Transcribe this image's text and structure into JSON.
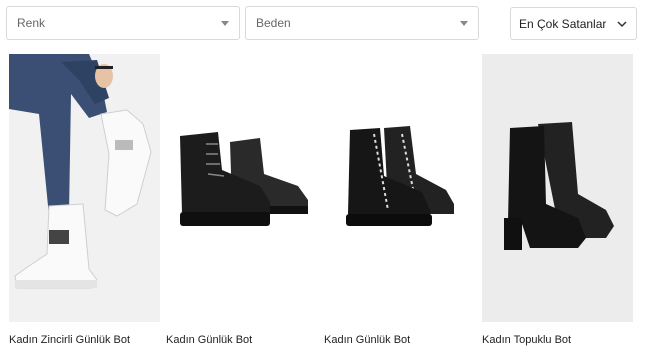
{
  "filters": {
    "color_label": "Renk",
    "size_label": "Beden"
  },
  "sort": {
    "selected": "En Çok Satanlar"
  },
  "products": [
    {
      "name": "Kadın Zincirli Günlük Bot",
      "color": "white"
    },
    {
      "name": "Kadın Günlük Bot",
      "color": "black"
    },
    {
      "name": "Kadın Günlük Bot",
      "color": "black"
    },
    {
      "name": "Kadın Topuklu Bot",
      "color": "black"
    }
  ],
  "colors": {
    "border": "#d9d9d9",
    "image_bg_white_boot": "#f1f1f1",
    "image_bg_heeled_boot": "#ececec",
    "boot_black": "#1c1c1c",
    "denim": "#3a4f73"
  }
}
